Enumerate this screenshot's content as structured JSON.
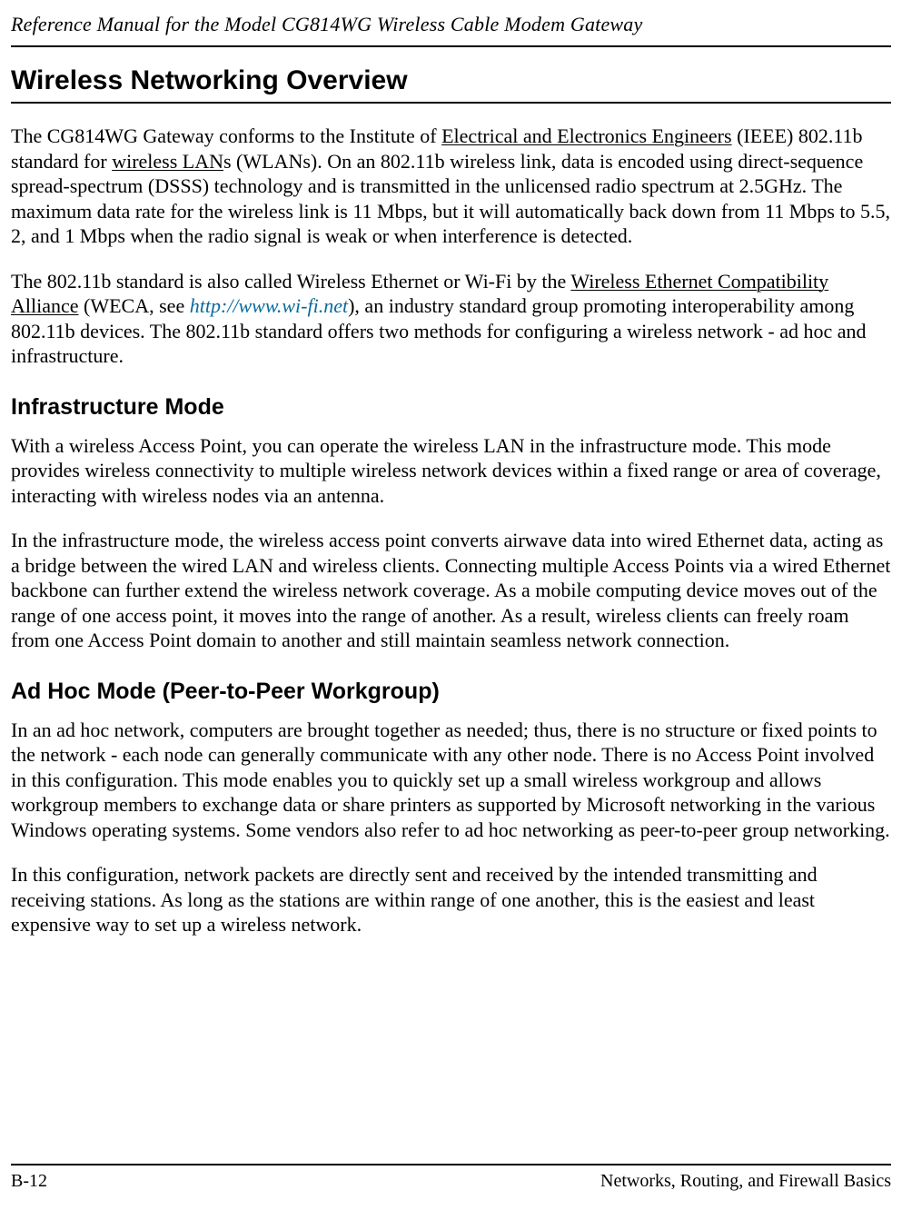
{
  "header": {
    "running_title": "Reference Manual for the Model CG814WG Wireless Cable Modem Gateway"
  },
  "glossary": {
    "ieee": "Electrical and Electronics Engineers",
    "wlan": "wireless LAN",
    "weca": "Wireless Ethernet Compatibility Alliance"
  },
  "links": {
    "wifi_url": "http://www.wi-fi.net"
  },
  "sections": {
    "overview": {
      "title": "Wireless Networking Overview",
      "p1": {
        "t1": "The CG814WG Gateway conforms to the Institute of ",
        "t2": " (IEEE) 802.11b standard for ",
        "t3": "s (WLANs). On an 802.11b wireless link, data is encoded using direct-sequence spread-spectrum (DSSS) technology and is transmitted in the unlicensed radio spectrum at 2.5GHz. The maximum data rate for the wireless link is 11 Mbps, but it will automatically back down from 11 Mbps to 5.5, 2, and 1 Mbps when the radio signal is weak or when interference is detected."
      },
      "p2": {
        "t1": "The 802.11b standard is also called Wireless Ethernet or Wi-Fi by the ",
        "t2": " (WECA, see ",
        "t3": "), an industry standard group promoting interoperability among 802.11b devices. The 802.11b standard offers two methods for configuring a wireless network - ad hoc and infrastructure."
      }
    },
    "infrastructure": {
      "title": "Infrastructure Mode",
      "p1": "With a wireless Access Point, you can operate the wireless LAN in the infrastructure mode. This mode provides wireless connectivity to multiple wireless network devices within a fixed range or area of coverage, interacting with wireless nodes via an antenna.",
      "p2": "In the infrastructure mode, the wireless access point converts airwave data into wired Ethernet data, acting as a bridge between the wired LAN and wireless clients. Connecting multiple Access Points via a wired Ethernet backbone can further extend the wireless network coverage. As a mobile computing device moves out of the range of one access point, it moves into the range of another. As a result, wireless clients can freely roam from one Access Point domain to another and still maintain seamless network connection."
    },
    "adhoc": {
      "title": "Ad Hoc Mode (Peer-to-Peer Workgroup)",
      "p1": "In an ad hoc network, computers are brought together as needed; thus, there is no structure or fixed points to the network - each node can generally communicate with any other node. There is no Access Point involved in this configuration. This mode enables you to quickly set up a small wireless workgroup and allows workgroup members to exchange data or share printers as supported by Microsoft networking in the various Windows operating systems. Some vendors also refer to ad hoc networking as peer-to-peer group networking.",
      "p2": "In this configuration, network packets are directly sent and received by the intended transmitting and receiving stations. As long as the stations are within range of one another, this is the easiest and least expensive way to set up a wireless network."
    }
  },
  "footer": {
    "page_number": "B-12",
    "chapter_title": "Networks, Routing, and Firewall Basics"
  }
}
